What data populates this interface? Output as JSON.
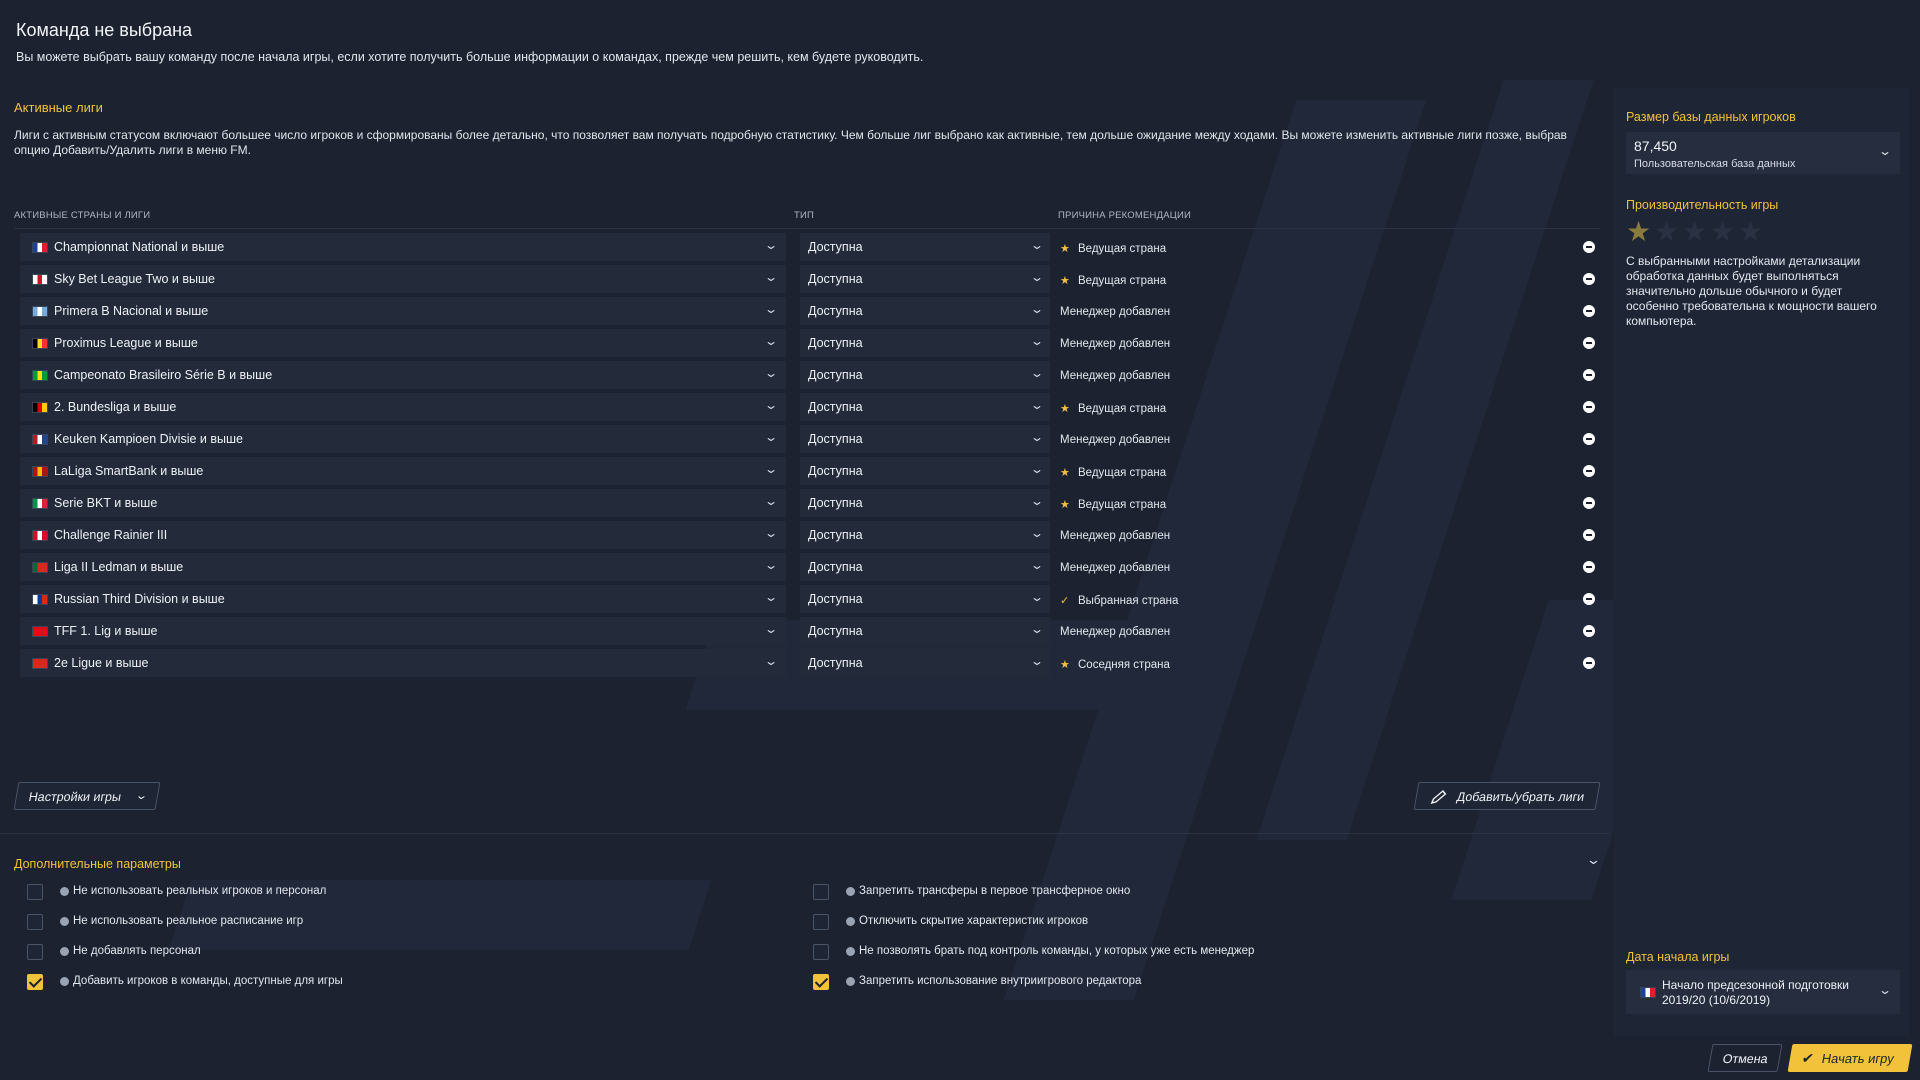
{
  "header": {
    "title": "Команда не выбрана",
    "subtitle": "Вы можете выбрать вашу команду после начала игры, если хотите получить больше информации о командах, прежде чем решить, кем будете руководить."
  },
  "active_leagues": {
    "title": "Активные лиги",
    "description": "Лиги с активным статусом включают большее число игроков и сформированы более детально, что позволяет вам получать подробную статистику. Чем больше лиг выбрано как активные, тем дольше ожидание между ходами. Вы можете изменить активные лиги позже, выбрав опцию Добавить/Удалить лиги в меню FM.",
    "columns": {
      "countries": "АКТИВНЫЕ СТРАНЫ И ЛИГИ",
      "type": "ТИП",
      "reason": "ПРИЧИНА РЕКОМЕНДАЦИИ"
    },
    "rows": [
      {
        "league": "Championnat National и выше",
        "type": "Доступна",
        "reason": "Ведущая страна",
        "icon": "star",
        "flag": [
          "#1f3f99",
          "#ffffff",
          "#d8232a"
        ]
      },
      {
        "league": "Sky Bet League Two и выше",
        "type": "Доступна",
        "reason": "Ведущая страна",
        "icon": "star",
        "flag": [
          "#ffffff",
          "#ce1124",
          "#ffffff"
        ]
      },
      {
        "league": "Primera B Nacional и выше",
        "type": "Доступна",
        "reason": "Менеджер добавлен",
        "icon": "",
        "flag": [
          "#74acdf",
          "#ffffff",
          "#74acdf"
        ]
      },
      {
        "league": "Proximus League и выше",
        "type": "Доступна",
        "reason": "Менеджер добавлен",
        "icon": "",
        "flag": [
          "#000000",
          "#fdda24",
          "#ef3340"
        ]
      },
      {
        "league": "Campeonato Brasileiro Série B и выше",
        "type": "Доступна",
        "reason": "Менеджер добавлен",
        "icon": "",
        "flag": [
          "#009c3b",
          "#ffdf00",
          "#009c3b"
        ]
      },
      {
        "league": "2. Bundesliga и выше",
        "type": "Доступна",
        "reason": "Ведущая страна",
        "icon": "star",
        "flag": [
          "#000000",
          "#dd0000",
          "#ffce00"
        ]
      },
      {
        "league": "Keuken Kampioen Divisie и выше",
        "type": "Доступна",
        "reason": "Менеджер добавлен",
        "icon": "",
        "flag": [
          "#ae1c28",
          "#ffffff",
          "#21468b"
        ]
      },
      {
        "league": "LaLiga SmartBank и выше",
        "type": "Доступна",
        "reason": "Ведущая страна",
        "icon": "star",
        "flag": [
          "#aa151b",
          "#f1bf00",
          "#aa151b"
        ]
      },
      {
        "league": "Serie BKT и выше",
        "type": "Доступна",
        "reason": "Ведущая страна",
        "icon": "star",
        "flag": [
          "#009246",
          "#ffffff",
          "#ce2b37"
        ]
      },
      {
        "league": "Challenge Rainier III",
        "type": "Доступна",
        "reason": "Менеджер добавлен",
        "icon": "",
        "flag": [
          "#ce1126",
          "#ffffff",
          "#ce1126"
        ]
      },
      {
        "league": "Liga II Ledman и выше",
        "type": "Доступна",
        "reason": "Менеджер добавлен",
        "icon": "",
        "flag": [
          "#046a38",
          "#da291c",
          "#da291c"
        ]
      },
      {
        "league": "Russian Third Division и выше",
        "type": "Доступна",
        "reason": "Выбранная страна",
        "icon": "check",
        "flag": [
          "#ffffff",
          "#0039a6",
          "#d52b1e"
        ]
      },
      {
        "league": "TFF 1. Lig и выше",
        "type": "Доступна",
        "reason": "Менеджер добавлен",
        "icon": "",
        "flag": [
          "#e30a17",
          "#e30a17",
          "#e30a17"
        ]
      },
      {
        "league": "2e Ligue и выше",
        "type": "Доступна",
        "reason": "Соседняя страна",
        "icon": "star",
        "flag": [
          "#da291c",
          "#da291c",
          "#da291c"
        ]
      }
    ]
  },
  "buttons": {
    "game_settings": "Настройки игры",
    "add_remove_leagues": "Добавить/убрать лиги",
    "cancel": "Отмена",
    "start_game": "Начать игру"
  },
  "extra_params": {
    "title": "Дополнительные параметры",
    "options": [
      {
        "label": "Не использовать реальных игроков и персонал",
        "checked": false
      },
      {
        "label": "Не использовать реальное расписание игр",
        "checked": false
      },
      {
        "label": "Не добавлять персонал",
        "checked": false
      },
      {
        "label": "Добавить игроков в команды, доступные для игры",
        "checked": true
      },
      {
        "label": "Запретить трансферы в первое трансферное окно",
        "checked": false
      },
      {
        "label": "Отключить скрытие характеристик игроков",
        "checked": false
      },
      {
        "label": "Не позволять брать под контроль команды, у которых уже есть менеджер",
        "checked": false
      },
      {
        "label": "Запретить использование внутриигрового редактора",
        "checked": true
      }
    ]
  },
  "side_panel": {
    "db_title": "Размер базы данных игроков",
    "db_value": "87,450",
    "db_label": "Пользовательская база данных",
    "perf_title": "Производительность игры",
    "perf_rating": 1,
    "perf_max": 5,
    "perf_text": "С выбранными настройками детализации обработка данных будет выполняться значительно дольше обычного и будет особенно требовательна к мощности вашего компьютера.",
    "start_date_title": "Дата начала игры",
    "start_date_value": "Начало предсезонной подготовки 2019/20 (10/6/2019)"
  },
  "colors": {
    "accent": "#f2c23a",
    "background": "#1c2230",
    "row": "#232b3b"
  }
}
